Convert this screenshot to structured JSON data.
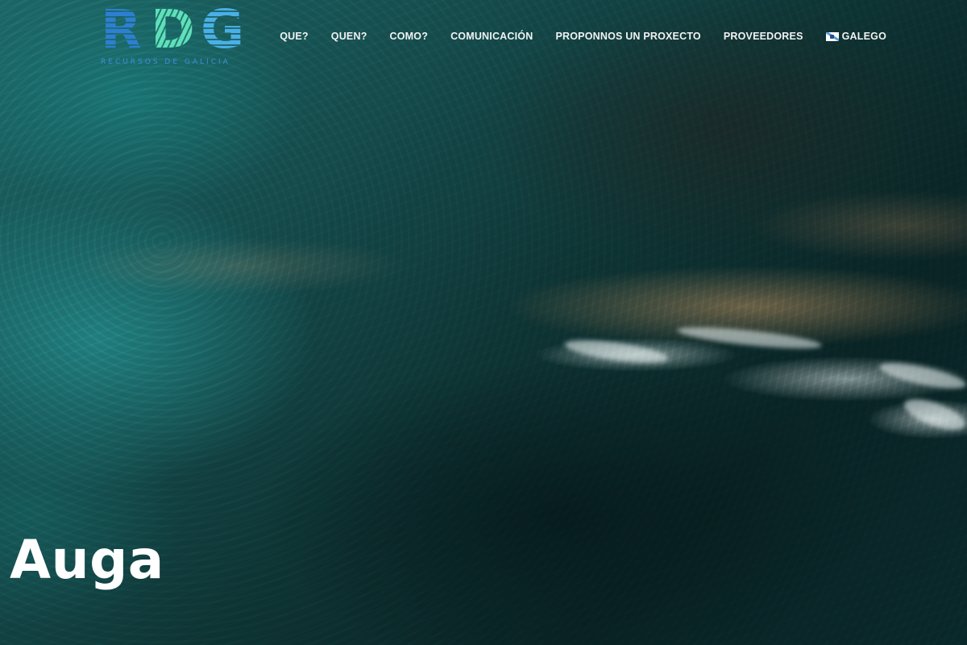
{
  "logo": {
    "letters": [
      "R",
      "D",
      "G"
    ],
    "tagline": "RECURSOS DE GALICIA"
  },
  "nav": {
    "items": [
      {
        "label": "QUE?"
      },
      {
        "label": "QUEN?"
      },
      {
        "label": "COMO?"
      },
      {
        "label": "COMUNICACIÓN"
      },
      {
        "label": "PROPONNOS UN PROXECTO"
      },
      {
        "label": "PROVEEDORES"
      }
    ],
    "language": {
      "label": "GALEGO",
      "icon": "galician-flag-icon"
    }
  },
  "hero": {
    "title": "Auga"
  },
  "colors": {
    "logo_r": "#2d7fd3",
    "logo_d": "#5fe0b8",
    "logo_g": "#4ab0e6",
    "nav_text": "#f1f3f3",
    "title_text": "#ffffff"
  }
}
